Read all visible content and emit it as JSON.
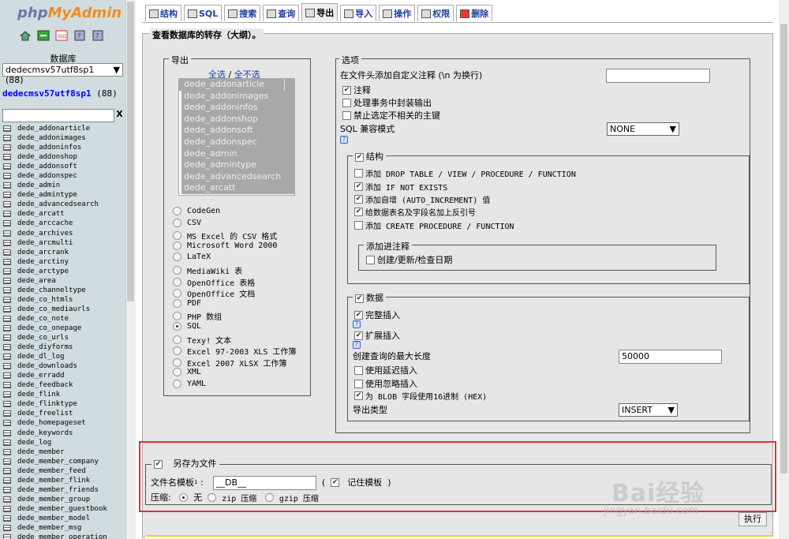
{
  "logo": {
    "part1": "php",
    "part2": "MyAdmin"
  },
  "sidebar": {
    "db_label": "数据库",
    "db_select": "dedecmsv57utf8sp1 (88)",
    "db_name": "dedecmsv57utf8sp1",
    "db_count": "(88)",
    "filter_clear": "X",
    "tables": [
      "dede_addonarticle",
      "dede_addonimages",
      "dede_addoninfos",
      "dede_addonshop",
      "dede_addonsoft",
      "dede_addonspec",
      "dede_admin",
      "dede_admintype",
      "dede_advancedsearch",
      "dede_arcatt",
      "dede_arccache",
      "dede_archives",
      "dede_arcmulti",
      "dede_arcrank",
      "dede_arctiny",
      "dede_arctype",
      "dede_area",
      "dede_channeltype",
      "dede_co_htmls",
      "dede_co_mediaurls",
      "dede_co_note",
      "dede_co_onepage",
      "dede_co_urls",
      "dede_diyforms",
      "dede_dl_log",
      "dede_downloads",
      "dede_erradd",
      "dede_feedback",
      "dede_flink",
      "dede_flinktype",
      "dede_freelist",
      "dede_homepageset",
      "dede_keywords",
      "dede_log",
      "dede_member",
      "dede_member_company",
      "dede_member_feed",
      "dede_member_flink",
      "dede_member_friends",
      "dede_member_group",
      "dede_member_guestbook",
      "dede_member_model",
      "dede_member_msg",
      "dede_member_operation"
    ]
  },
  "tabs": [
    "结构",
    "SQL",
    "搜索",
    "查询",
    "导出",
    "导入",
    "操作",
    "权限",
    "删除"
  ],
  "active_tab": "导出",
  "main": {
    "title": "查看数据库的转存（大纲）。",
    "export_legend": "导出",
    "select_all": "全选",
    "slash": "/",
    "select_none": "全不选",
    "export_tables": [
      "dede_addonarticle",
      "dede_addonimages",
      "dede_addoninfos",
      "dede_addonshop",
      "dede_addonsoft",
      "dede_addonspec",
      "dede_admin",
      "dede_admintype",
      "dede_advancedsearch",
      "dede_arcatt"
    ],
    "formats": [
      "CodeGen",
      "CSV",
      "MS Excel 的 CSV 格式",
      "Microsoft Word 2000",
      "LaTeX",
      "MediaWiki 表",
      "OpenOffice 表格",
      "OpenOffice 文档",
      "PDF",
      "PHP 数组",
      "SQL",
      "Texy! 文本",
      "Excel 97-2003 XLS 工作簿",
      "Excel 2007 XLSX 工作簿",
      "XML",
      "YAML"
    ],
    "selected_format": "SQL",
    "options_legend": "选项",
    "header_comment_label": "在文件头添加自定义注释 (\\n 为换行)",
    "comments": "注释",
    "transaction": "处理事务中封装输出",
    "disable_fk": "禁止选定不相关的主键",
    "sql_compat": "SQL 兼容模式",
    "sql_compat_value": "NONE",
    "structure_legend": "结构",
    "drop_table": "添加 DROP TABLE / VIEW / PROCEDURE / FUNCTION",
    "if_not_exists": "添加 IF NOT EXISTS",
    "auto_increment": "添加自增 (AUTO_INCREMENT) 值",
    "backquotes": "给数据表名及字段名加上反引号",
    "create_procedure": "添加 CREATE PROCEDURE / FUNCTION",
    "add_comments_legend": "添加进注释",
    "dates": "创建/更新/检查日期",
    "data_legend": "数据",
    "complete_insert": "完整插入",
    "extended_insert": "扩展插入",
    "max_query_label": "创建查询的最大长度",
    "max_query_value": "50000",
    "delayed": "使用延迟插入",
    "ignore": "使用忽略插入",
    "hex": "为 BLOB 字段使用16进制 (HEX)",
    "export_type_label": "导出类型",
    "export_type_value": "INSERT",
    "save_file_legend": "另存为文件",
    "filename_label": "文件名模板",
    "filename_sup": "1",
    "filename_colon": ":",
    "filename_value": "__DB__",
    "paren_open": "(",
    "remember_template": "记住模板",
    "paren_close": ")",
    "compression_label": "压缩:",
    "none": "无",
    "zip": "zip 压缩",
    "gzip": "gzip 压缩",
    "go_button": "执行"
  },
  "watermark": {
    "brand": "Bai经验",
    "url": "jingyan.baidu.com"
  },
  "colors": {
    "highlight_box": "#e03030",
    "link": "#2040a0",
    "sidebar_bg": "#d0dce0"
  }
}
